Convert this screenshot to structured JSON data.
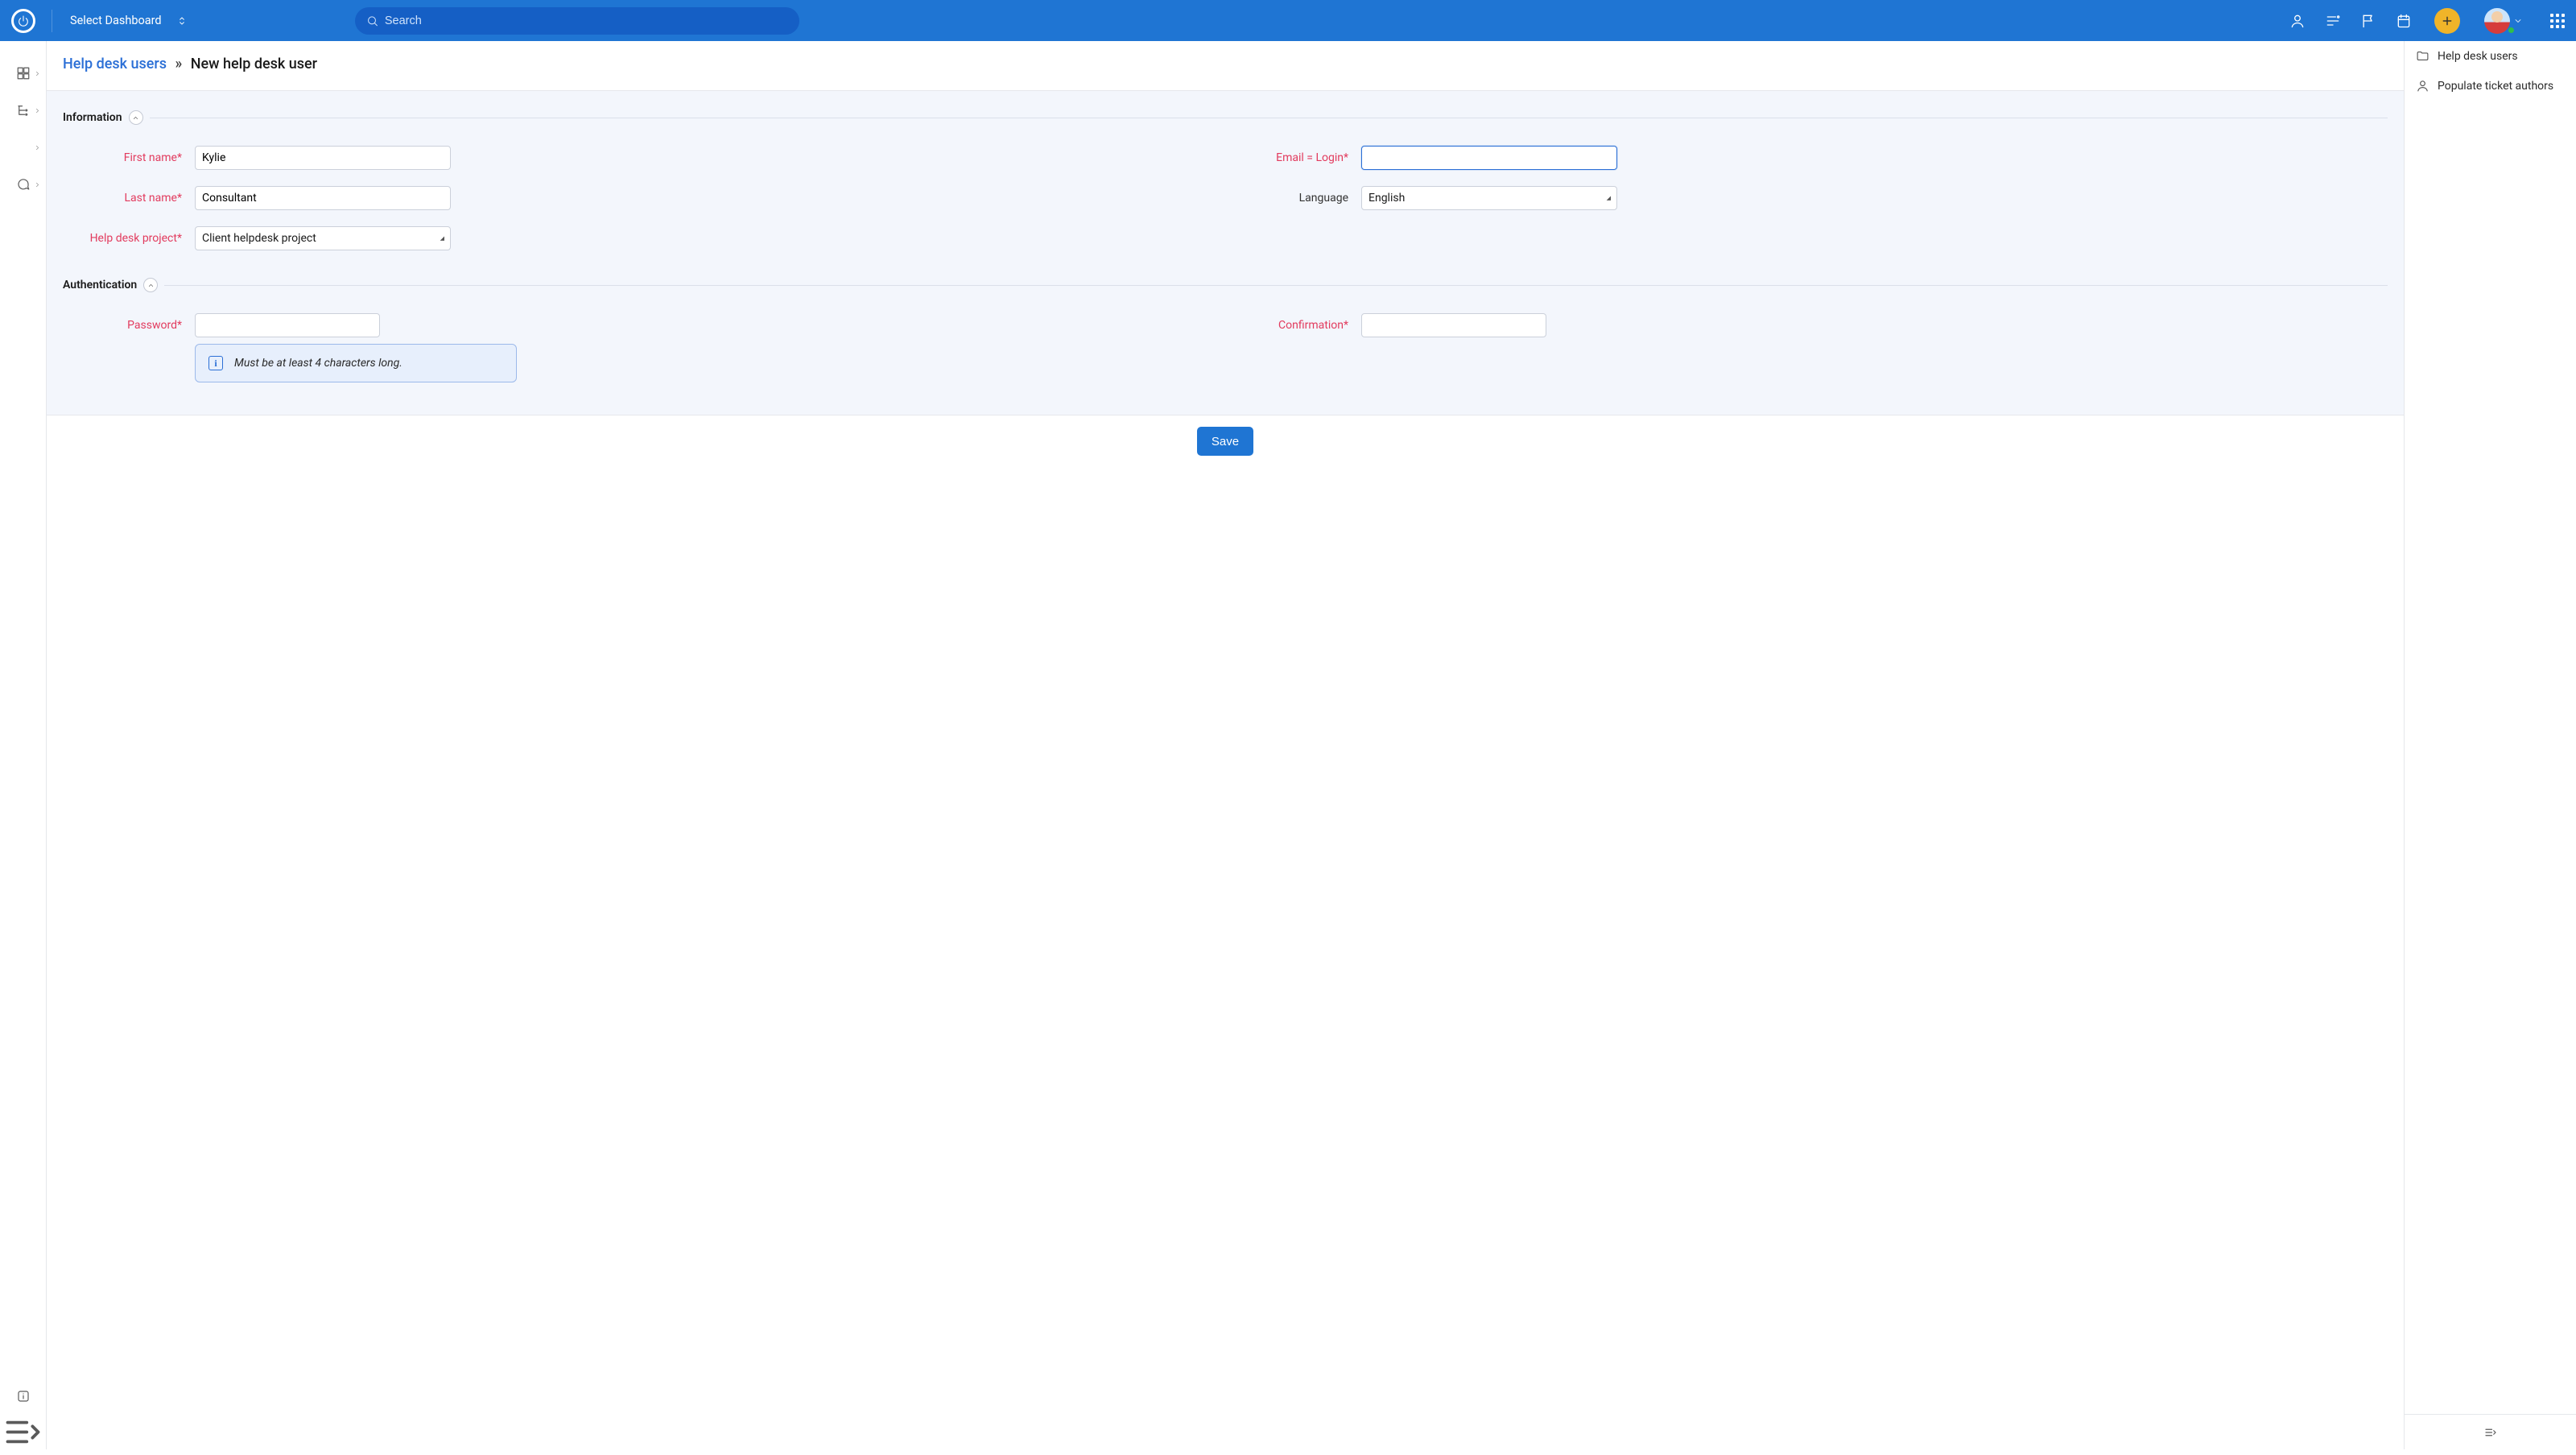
{
  "header": {
    "select_dashboard": "Select Dashboard",
    "search_placeholder": "Search"
  },
  "breadcrumb": {
    "parent": "Help desk users",
    "current": "New help desk user"
  },
  "sections": {
    "information": "Information",
    "authentication": "Authentication"
  },
  "labels": {
    "first_name": "First name",
    "last_name": "Last name",
    "helpdesk_project": "Help desk project",
    "email_login": "Email = Login",
    "language": "Language",
    "password": "Password",
    "confirmation": "Confirmation"
  },
  "values": {
    "first_name": "Kylie",
    "last_name": "Consultant",
    "helpdesk_project": "Client helpdesk project",
    "email_login": "",
    "language": "English",
    "password": "",
    "confirmation": ""
  },
  "hints": {
    "password": "Must be at least 4 characters long."
  },
  "buttons": {
    "save": "Save"
  },
  "rightbar": {
    "items": [
      "Help desk users",
      "Populate ticket authors"
    ]
  }
}
